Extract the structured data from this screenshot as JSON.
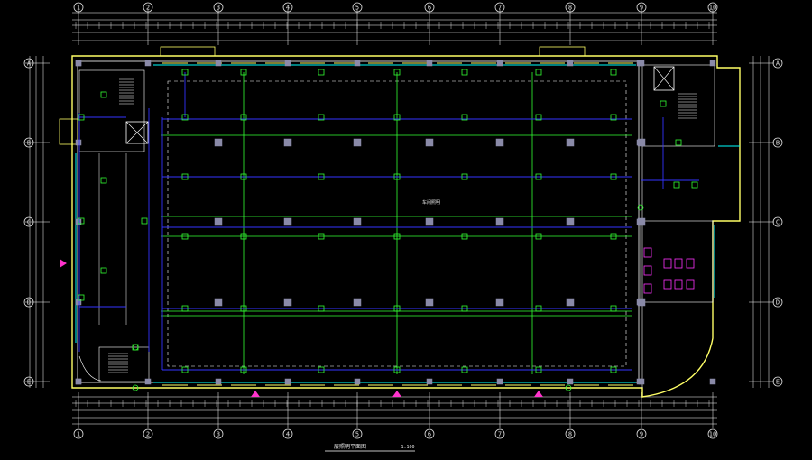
{
  "drawing": {
    "title": "一层照明平面图",
    "scale": "1:100",
    "room_label_line1": "车间照明",
    "room_label_line2": "",
    "colors": {
      "background": "#000000",
      "wall": "#ffff66",
      "wall_inner": "#ffffff",
      "cyan": "#00ffff",
      "blue_conduit": "#3333ff",
      "green_grid": "#33ff33",
      "column": "#8a8aa8",
      "magenta": "#ff33ff",
      "dimension": "#ffffff",
      "entrance_marker": "#ff33cc"
    }
  },
  "axes": {
    "vertical": [
      "1",
      "2",
      "3",
      "4",
      "5",
      "6",
      "7",
      "8",
      "9",
      "10"
    ],
    "horizontal": [
      "A",
      "B",
      "C",
      "D",
      "E"
    ]
  }
}
